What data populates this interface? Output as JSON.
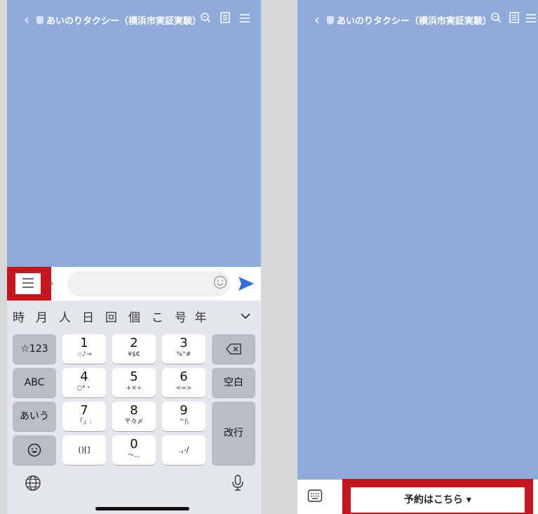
{
  "colors": {
    "chat_bg": "#8eabda",
    "highlight": "#c4161c",
    "send_blue": "#2f6ee6",
    "keyboard_bg": "#e3e6ea"
  },
  "left": {
    "header": {
      "back_icon": "chevron-left-icon",
      "title": "あいのりタクシー（横浜市実証実験）"
    },
    "input_placeholder": "",
    "candidates": [
      "時",
      "月",
      "人",
      "日",
      "回",
      "個",
      "こ",
      "号",
      "年"
    ],
    "keys": {
      "mode_symbol": "☆123",
      "mode_abc": "ABC",
      "mode_kana": "あいう",
      "k1": {
        "main": "1",
        "sub": "☆♪→"
      },
      "k2": {
        "main": "2",
        "sub": "¥$€"
      },
      "k3": {
        "main": "3",
        "sub": "%°#"
      },
      "k4": {
        "main": "4",
        "sub": "○*・"
      },
      "k5": {
        "main": "5",
        "sub": "+×÷"
      },
      "k6": {
        "main": "6",
        "sub": "<=>"
      },
      "k7": {
        "main": "7",
        "sub": "「」:"
      },
      "k8": {
        "main": "8",
        "sub": "〒々〆"
      },
      "k9": {
        "main": "9",
        "sub": "^|\\"
      },
      "k0": {
        "main": "0",
        "sub": "〜…"
      },
      "brackets": "()[]",
      "punct": ".,-/",
      "space": "空白",
      "enter": "改行"
    }
  },
  "right": {
    "header": {
      "title": "あいのりタクシー（横浜市実証実験）"
    },
    "reserve_label": "予約はこちら ▾"
  }
}
